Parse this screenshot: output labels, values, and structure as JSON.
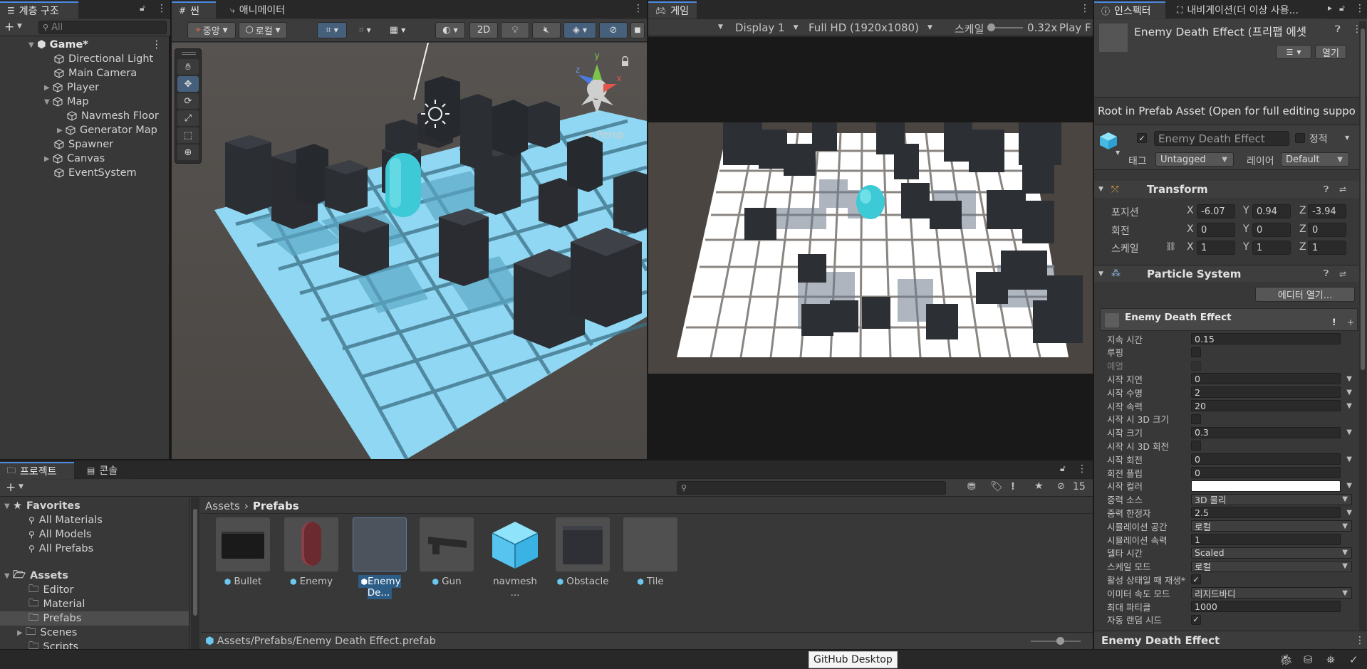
{
  "hierarchy": {
    "tab_label": "계층 구조",
    "search_placeholder": "All",
    "items": [
      {
        "label": "Game*"
      },
      {
        "label": "Directional Light"
      },
      {
        "label": "Main Camera"
      },
      {
        "label": "Player"
      },
      {
        "label": "Map"
      },
      {
        "label": "Navmesh Floor"
      },
      {
        "label": "Generator Map"
      },
      {
        "label": "Spawner"
      },
      {
        "label": "Canvas"
      },
      {
        "label": "EventSystem"
      }
    ]
  },
  "scene": {
    "tab_scene": "씬",
    "tab_animator": "애니메이터",
    "pivot_label": "중앙",
    "space_label": "로컬",
    "mode_2d": "2D",
    "gizmo_label": "Persp",
    "gizmo_axis_y": "y",
    "gizmo_axis_z": "z",
    "gizmo_axis_x": "x"
  },
  "game": {
    "tab_label": "게임",
    "display": "Display 1",
    "resolution": "Full HD (1920x1080)",
    "scale_label": "스케일",
    "scale_value": "0.32x",
    "play_focus": "Play F"
  },
  "project": {
    "tab_project": "프로젝트",
    "tab_console": "콘솔",
    "hidden_count": "15",
    "favorites_label": "Favorites",
    "favorites": [
      "All Materials",
      "All Models",
      "All Prefabs"
    ],
    "assets_label": "Assets",
    "folders": [
      "Editor",
      "Material",
      "Prefabs",
      "Scenes",
      "Scripts"
    ],
    "breadcrumb": [
      "Assets",
      "Prefabs"
    ],
    "assets": [
      {
        "label": "Bullet"
      },
      {
        "label": "Enemy"
      },
      {
        "label": "Enemy De..."
      },
      {
        "label": "Gun"
      },
      {
        "label": "navmesh ..."
      },
      {
        "label": "Obstacle"
      },
      {
        "label": "Tile"
      }
    ],
    "path": "Assets/Prefabs/Enemy Death Effect.prefab"
  },
  "inspector": {
    "tab_inspector": "인스펙터",
    "tab_navigation": "내비게이션(더 이상 사용...",
    "title": "Enemy Death Effect (프리팹 에셋",
    "open_button": "열기",
    "root_info": "Root in Prefab Asset (Open for full editing suppo",
    "object_name": "Enemy Death Effect",
    "static_label": "정적",
    "tag_label": "태그",
    "tag_value": "Untagged",
    "layer_label": "레이어",
    "layer_value": "Default",
    "transform": {
      "title": "Transform",
      "position_label": "포지션",
      "rotation_label": "회전",
      "scale_label": "스케일",
      "axis_x": "X",
      "axis_y": "Y",
      "axis_z": "Z",
      "position": [
        "-6.07",
        "0.94",
        "-3.94"
      ],
      "rotation": [
        "0",
        "0",
        "0"
      ],
      "scale": [
        "1",
        "1",
        "1"
      ]
    },
    "particle": {
      "title": "Particle System",
      "editor_button": "에디터 열기...",
      "module_name": "Enemy Death Effect",
      "properties": [
        {
          "label": "지속 시간",
          "value": "0.15",
          "type": "field"
        },
        {
          "label": "루핑",
          "value": "",
          "type": "check"
        },
        {
          "label": "예열",
          "value": "",
          "type": "check-disabled"
        },
        {
          "label": "시작 지연",
          "value": "0",
          "type": "field-dd"
        },
        {
          "label": "시작 수명",
          "value": "2",
          "type": "field-dd"
        },
        {
          "label": "시작 속력",
          "value": "20",
          "type": "field-dd"
        },
        {
          "label": "시작 시 3D 크기",
          "value": "",
          "type": "check"
        },
        {
          "label": "시작 크기",
          "value": "0.3",
          "type": "field-dd"
        },
        {
          "label": "시작 시 3D 회전",
          "value": "",
          "type": "check"
        },
        {
          "label": "시작 회전",
          "value": "0",
          "type": "field-dd"
        },
        {
          "label": "회전 플립",
          "value": "0",
          "type": "field"
        },
        {
          "label": "시작 컬러",
          "value": "",
          "type": "color"
        },
        {
          "label": "중력 소스",
          "value": "3D 물리",
          "type": "dropdown"
        },
        {
          "label": "중력 한정자",
          "value": "2.5",
          "type": "field-dd"
        },
        {
          "label": "시뮬레이션 공간",
          "value": "로컬",
          "type": "dropdown"
        },
        {
          "label": "시뮬레이션 속력",
          "value": "1",
          "type": "field"
        },
        {
          "label": "델타 시간",
          "value": "Scaled",
          "type": "dropdown"
        },
        {
          "label": "스케일 모드",
          "value": "로컬",
          "type": "dropdown"
        },
        {
          "label": "활성 상태일 때 재생*",
          "value": "✓",
          "type": "check"
        },
        {
          "label": "이미터 속도 모드",
          "value": "리지드바디",
          "type": "dropdown"
        },
        {
          "label": "최대 파티클",
          "value": "1000",
          "type": "field"
        },
        {
          "label": "자동 랜덤 시드",
          "value": "✓",
          "type": "check"
        }
      ],
      "footer_title": "Enemy Death Effect"
    }
  },
  "status": {
    "tooltip": "GitHub Desktop"
  },
  "colors": {
    "accent": "#4d8ae0",
    "selection": "#2c5d87",
    "floor": "#8fd7f2",
    "capsule": "#3ec9d6",
    "obstacle": "#2b2e33"
  }
}
